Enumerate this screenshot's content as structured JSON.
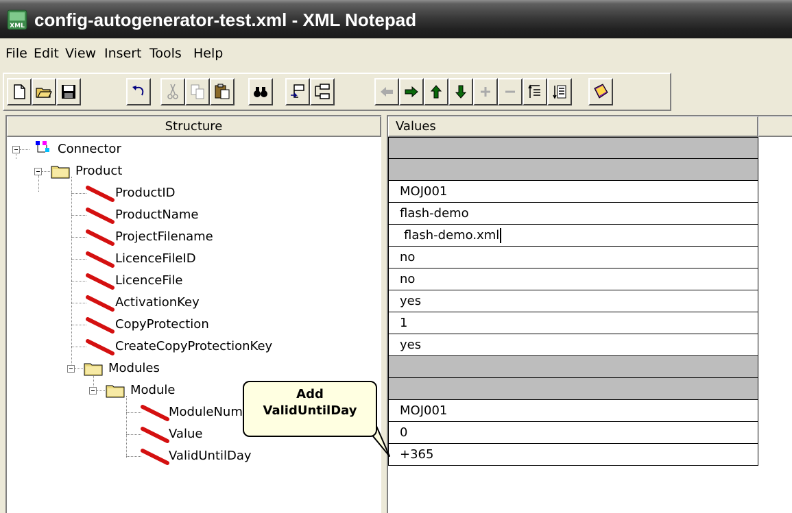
{
  "window": {
    "title": "config-autogenerator-test.xml - XML Notepad"
  },
  "menu": [
    "File",
    "Edit",
    "View",
    "Insert",
    "Tools",
    "Help"
  ],
  "toolbar": {
    "buttons": [
      "new",
      "open",
      "save",
      "undo",
      "cut",
      "copy",
      "paste",
      "find",
      "insert-before",
      "insert-child",
      "nudge-left",
      "nudge-right",
      "nudge-up",
      "nudge-down",
      "expand",
      "collapse",
      "indent-up",
      "indent-all",
      "help"
    ]
  },
  "panes": {
    "structure_header": "Structure",
    "values_header": "Values"
  },
  "tree": [
    {
      "label": "Connector",
      "type": "root",
      "value": ""
    },
    {
      "label": "Product",
      "type": "folder",
      "value": ""
    },
    {
      "label": "ProductID",
      "type": "attr",
      "value": "MOJ001"
    },
    {
      "label": "ProductName",
      "type": "attr",
      "value": "flash-demo"
    },
    {
      "label": "ProjectFilename",
      "type": "attr",
      "value": "flash-demo.xml"
    },
    {
      "label": "LicenceFileID",
      "type": "attr",
      "value": "no"
    },
    {
      "label": "LicenceFile",
      "type": "attr",
      "value": "no"
    },
    {
      "label": "ActivationKey",
      "type": "attr",
      "value": "yes"
    },
    {
      "label": "CopyProtection",
      "type": "attr",
      "value": "1"
    },
    {
      "label": "CreateCopyProtectionKey",
      "type": "attr",
      "value": "yes"
    },
    {
      "label": "Modules",
      "type": "folder",
      "value": ""
    },
    {
      "label": "Module",
      "type": "folder",
      "value": ""
    },
    {
      "label": "ModuleNum",
      "type": "attr",
      "value": "MOJ001"
    },
    {
      "label": "Value",
      "type": "attr",
      "value": "0"
    },
    {
      "label": "ValidUntilDay",
      "type": "attr",
      "value": "+365"
    }
  ],
  "callout": {
    "line1": "Add",
    "line2": "ValidUntilDay"
  }
}
